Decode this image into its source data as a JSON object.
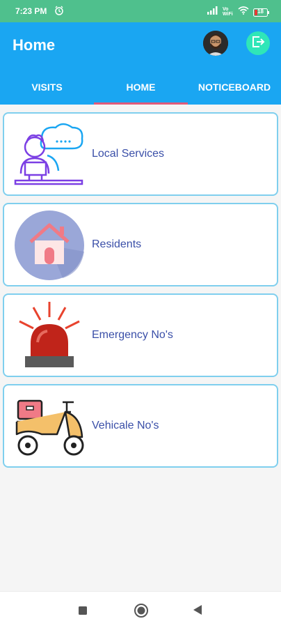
{
  "status_bar": {
    "time": "7:23 PM",
    "icons": [
      "alarm-icon",
      "signal-icon",
      "vowifi-icon",
      "wifi-icon",
      "battery-icon"
    ],
    "vowifi_text": "Vo WiFi",
    "battery_level": "18"
  },
  "header": {
    "title": "Home",
    "color": "#1aa6f2",
    "avatar": "avatar",
    "logout_icon": "logout-icon"
  },
  "tabs": [
    {
      "label": "VISITS",
      "selected": false
    },
    {
      "label": "HOME",
      "selected": true
    },
    {
      "label": "NOTICEBOARD",
      "selected": false
    }
  ],
  "cards": [
    {
      "label": "Local Services",
      "icon": "worker-icon"
    },
    {
      "label": "Residents",
      "icon": "house-icon"
    },
    {
      "label": "Emergency No's",
      "icon": "siren-icon"
    },
    {
      "label": "Vehicale No's",
      "icon": "scooter-icon"
    }
  ],
  "nav_bar": {
    "buttons": [
      "recents-button",
      "home-button",
      "back-button"
    ]
  }
}
